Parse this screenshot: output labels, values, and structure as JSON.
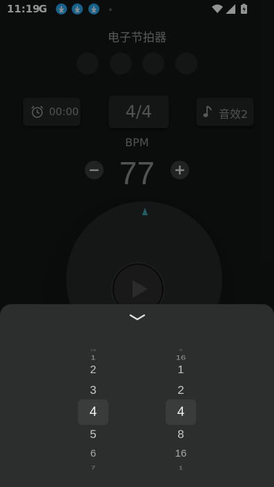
{
  "status_bar": {
    "time": "11:19",
    "g_label": "G",
    "icons": [
      "google-icon",
      "download-icon",
      "download-icon",
      "download-icon",
      "wifi-icon",
      "signal-icon",
      "battery-charging-icon"
    ]
  },
  "app": {
    "title": "电子节拍器"
  },
  "beat_indicators": 4,
  "controls": {
    "timer_label": "00:00",
    "time_signature": "4/4",
    "sound_label": "音效2"
  },
  "tempo": {
    "label": "BPM",
    "value": "77",
    "minus": "−",
    "plus": "+"
  },
  "picker": {
    "left_column": [
      "16",
      "1",
      "2",
      "3",
      "4",
      "5",
      "6",
      "7"
    ],
    "left_selected": "4",
    "right_column": [
      "8",
      "16",
      "1",
      "2",
      "4",
      "8",
      "16",
      "1"
    ],
    "right_selected": "4"
  },
  "colors": {
    "background": "#141616",
    "card": "#242525",
    "accent": "#3aa0a8",
    "sheet": "#2c2d2d",
    "status_download": "#2aa8f0"
  }
}
